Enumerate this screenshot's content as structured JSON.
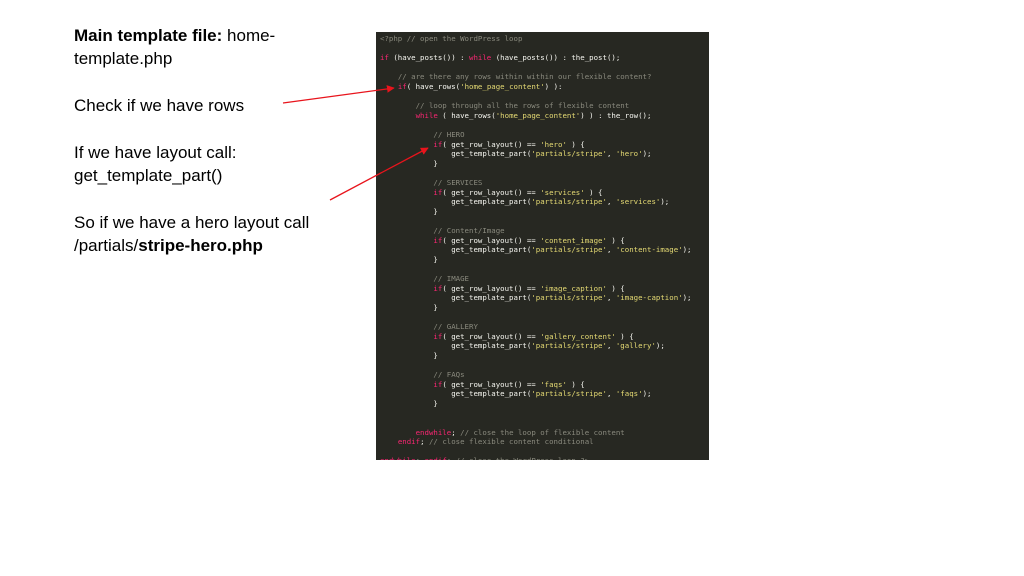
{
  "notes": [
    {
      "bold": "Main template file:",
      "text": " home-template.php"
    },
    {
      "bold": "",
      "text": "Check if we have rows"
    },
    {
      "bold": "",
      "text": "If we have layout call: get_template_part()"
    },
    {
      "bold": "",
      "text": "So if we have a hero layout call /partials/",
      "tail_bold": "stripe-hero.php"
    }
  ],
  "code_lines": [
    [
      [
        "c",
        "<?php"
      ],
      [
        "c",
        " // open the WordPress loop"
      ]
    ],
    [],
    [
      [
        "k",
        "if"
      ],
      [
        "",
        " (have_posts()) : "
      ],
      [
        "k",
        "while"
      ],
      [
        "",
        " (have_posts()) : the_post();"
      ]
    ],
    [],
    [
      [
        "",
        "    "
      ],
      [
        "c",
        "// are there any rows within within our flexible content?"
      ]
    ],
    [
      [
        "",
        "    "
      ],
      [
        "k",
        "if"
      ],
      [
        "",
        "( have_rows("
      ],
      [
        "s",
        "'home_page_content'"
      ],
      [
        "",
        ") ):"
      ]
    ],
    [],
    [
      [
        "",
        "        "
      ],
      [
        "c",
        "// loop through all the rows of flexible content"
      ]
    ],
    [
      [
        "",
        "        "
      ],
      [
        "k",
        "while"
      ],
      [
        "",
        " ( have_rows("
      ],
      [
        "s",
        "'home_page_content'"
      ],
      [
        "",
        ") ) : the_row();"
      ]
    ],
    [],
    [
      [
        "",
        "            "
      ],
      [
        "c",
        "// HERO"
      ]
    ],
    [
      [
        "",
        "            "
      ],
      [
        "k",
        "if"
      ],
      [
        "",
        "( get_row_layout() == "
      ],
      [
        "s",
        "'hero'"
      ],
      [
        "",
        " ) {"
      ]
    ],
    [
      [
        "",
        "                get_template_part("
      ],
      [
        "s",
        "'partials/stripe'"
      ],
      [
        "",
        ", "
      ],
      [
        "s",
        "'hero'"
      ],
      [
        "",
        ");"
      ]
    ],
    [
      [
        "",
        "            }"
      ]
    ],
    [],
    [
      [
        "",
        "            "
      ],
      [
        "c",
        "// SERVICES"
      ]
    ],
    [
      [
        "",
        "            "
      ],
      [
        "k",
        "if"
      ],
      [
        "",
        "( get_row_layout() == "
      ],
      [
        "s",
        "'services'"
      ],
      [
        "",
        " ) {"
      ]
    ],
    [
      [
        "",
        "                get_template_part("
      ],
      [
        "s",
        "'partials/stripe'"
      ],
      [
        "",
        ", "
      ],
      [
        "s",
        "'services'"
      ],
      [
        "",
        ");"
      ]
    ],
    [
      [
        "",
        "            }"
      ]
    ],
    [],
    [
      [
        "",
        "            "
      ],
      [
        "c",
        "// Content/Image"
      ]
    ],
    [
      [
        "",
        "            "
      ],
      [
        "k",
        "if"
      ],
      [
        "",
        "( get_row_layout() == "
      ],
      [
        "s",
        "'content_image'"
      ],
      [
        "",
        " ) {"
      ]
    ],
    [
      [
        "",
        "                get_template_part("
      ],
      [
        "s",
        "'partials/stripe'"
      ],
      [
        "",
        ", "
      ],
      [
        "s",
        "'content-image'"
      ],
      [
        "",
        ");"
      ]
    ],
    [
      [
        "",
        "            }"
      ]
    ],
    [],
    [
      [
        "",
        "            "
      ],
      [
        "c",
        "// IMAGE"
      ]
    ],
    [
      [
        "",
        "            "
      ],
      [
        "k",
        "if"
      ],
      [
        "",
        "( get_row_layout() == "
      ],
      [
        "s",
        "'image_caption'"
      ],
      [
        "",
        " ) {"
      ]
    ],
    [
      [
        "",
        "                get_template_part("
      ],
      [
        "s",
        "'partials/stripe'"
      ],
      [
        "",
        ", "
      ],
      [
        "s",
        "'image-caption'"
      ],
      [
        "",
        ");"
      ]
    ],
    [
      [
        "",
        "            }"
      ]
    ],
    [],
    [
      [
        "",
        "            "
      ],
      [
        "c",
        "// GALLERY"
      ]
    ],
    [
      [
        "",
        "            "
      ],
      [
        "k",
        "if"
      ],
      [
        "",
        "( get_row_layout() == "
      ],
      [
        "s",
        "'gallery_content'"
      ],
      [
        "",
        " ) {"
      ]
    ],
    [
      [
        "",
        "                get_template_part("
      ],
      [
        "s",
        "'partials/stripe'"
      ],
      [
        "",
        ", "
      ],
      [
        "s",
        "'gallery'"
      ],
      [
        "",
        ");"
      ]
    ],
    [
      [
        "",
        "            }"
      ]
    ],
    [],
    [
      [
        "",
        "            "
      ],
      [
        "c",
        "// FAQs"
      ]
    ],
    [
      [
        "",
        "            "
      ],
      [
        "k",
        "if"
      ],
      [
        "",
        "( get_row_layout() == "
      ],
      [
        "s",
        "'faqs'"
      ],
      [
        "",
        " ) {"
      ]
    ],
    [
      [
        "",
        "                get_template_part("
      ],
      [
        "s",
        "'partials/stripe'"
      ],
      [
        "",
        ", "
      ],
      [
        "s",
        "'faqs'"
      ],
      [
        "",
        ");"
      ]
    ],
    [
      [
        "",
        "            }"
      ]
    ],
    [],
    [],
    [
      [
        "",
        "        "
      ],
      [
        "k",
        "endwhile"
      ],
      [
        "",
        "; "
      ],
      [
        "c",
        "// close the loop of flexible content"
      ]
    ],
    [
      [
        "",
        "    "
      ],
      [
        "k",
        "endif"
      ],
      [
        "",
        "; "
      ],
      [
        "c",
        "// close flexible content conditional"
      ]
    ],
    [],
    [
      [
        "k",
        "endwhile"
      ],
      [
        "",
        "; "
      ],
      [
        "k",
        "endif"
      ],
      [
        "",
        "; "
      ],
      [
        "c",
        "// close the WordPress loop ?>"
      ]
    ]
  ],
  "colors": {
    "background": "#ffffff",
    "code_background": "#272822",
    "keyword": "#f92672",
    "string": "#e6db74",
    "comment": "#8a8a7e",
    "arrow": "#e8141c"
  }
}
